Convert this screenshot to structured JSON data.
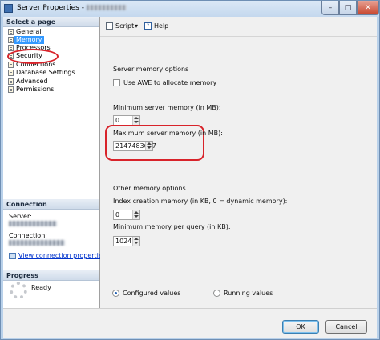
{
  "window": {
    "title": "Server Properties -",
    "min_glyph": "–",
    "max_glyph": "□",
    "close_glyph": "✕"
  },
  "left_pane": {
    "select_header": "Select a page",
    "pages": [
      "General",
      "Memory",
      "Processors",
      "Security",
      "Connections",
      "Database Settings",
      "Advanced",
      "Permissions"
    ],
    "selected_page": "Memory",
    "connection_header": "Connection",
    "server_label": "Server:",
    "connection_label": "Connection:",
    "view_connection_link": "View connection properties",
    "progress_header": "Progress",
    "progress_status": "Ready"
  },
  "toolbar": {
    "script_label": "Script",
    "dropdown_glyph": "▾",
    "help_label": "Help",
    "help_glyph": "?"
  },
  "server_memory": {
    "group_title": "Server memory options",
    "awe_label": "Use AWE to allocate memory",
    "awe_checked": false,
    "min_label": "Minimum server memory (in MB):",
    "min_value": "0",
    "max_label": "Maximum server memory (in MB):",
    "max_value": "2147483647"
  },
  "other_memory": {
    "group_title": "Other memory options",
    "index_label": "Index creation memory (in KB, 0 = dynamic memory):",
    "index_value": "0",
    "query_label": "Minimum memory per query (in KB):",
    "query_value": "1024"
  },
  "values_view": {
    "configured_label": "Configured values",
    "running_label": "Running values",
    "selected": "configured"
  },
  "buttons": {
    "ok": "OK",
    "cancel": "Cancel"
  },
  "colors": {
    "selection": "#3399ff",
    "annotation_red": "#d8232a",
    "link": "#0033cc"
  }
}
